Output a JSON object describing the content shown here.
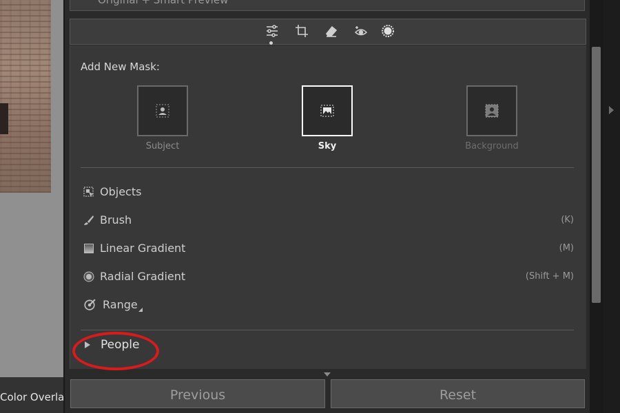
{
  "top_strip_text": "Original + Smart Preview",
  "left": {
    "overlay_label": "Color Overla"
  },
  "toolbar": {
    "tools": [
      {
        "icon": "sliders-icon"
      },
      {
        "icon": "crop-icon"
      },
      {
        "icon": "eraser-icon"
      },
      {
        "icon": "red-eye-icon"
      },
      {
        "icon": "masking-icon"
      }
    ]
  },
  "add_mask": {
    "title": "Add New Mask:",
    "tiles": [
      {
        "label": "Subject",
        "icon": "subject-person-icon",
        "selected": false
      },
      {
        "label": "Sky",
        "icon": "sky-image-icon",
        "selected": true
      },
      {
        "label": "Background",
        "icon": "background-person-icon",
        "selected": false
      }
    ]
  },
  "menu": [
    {
      "label": "Objects",
      "shortcut": "",
      "icon": "objects-select-icon"
    },
    {
      "label": "Brush",
      "shortcut": "(K)",
      "icon": "brush-icon"
    },
    {
      "label": "Linear Gradient",
      "shortcut": "(M)",
      "icon": "linear-gradient-icon"
    },
    {
      "label": "Radial Gradient",
      "shortcut": "(Shift + M)",
      "icon": "radial-gradient-icon"
    },
    {
      "label": "Range",
      "shortcut": "",
      "icon": "range-icon"
    }
  ],
  "people": {
    "label": "People"
  },
  "buttons": {
    "previous": "Previous",
    "reset": "Reset"
  },
  "colors": {
    "highlight_circle": "#d61c1c",
    "panel": "#383838"
  }
}
